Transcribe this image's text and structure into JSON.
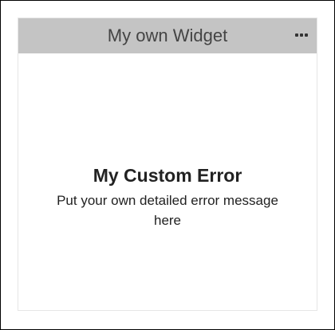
{
  "widget": {
    "title": "My own Widget",
    "menu_icon": "more-horizontal-icon",
    "error": {
      "title": "My Custom Error",
      "message": "Put your own detailed error message here"
    }
  },
  "colors": {
    "header_background": "#c4c4c4",
    "border": "#e6e6e6",
    "frame": "#000000"
  }
}
